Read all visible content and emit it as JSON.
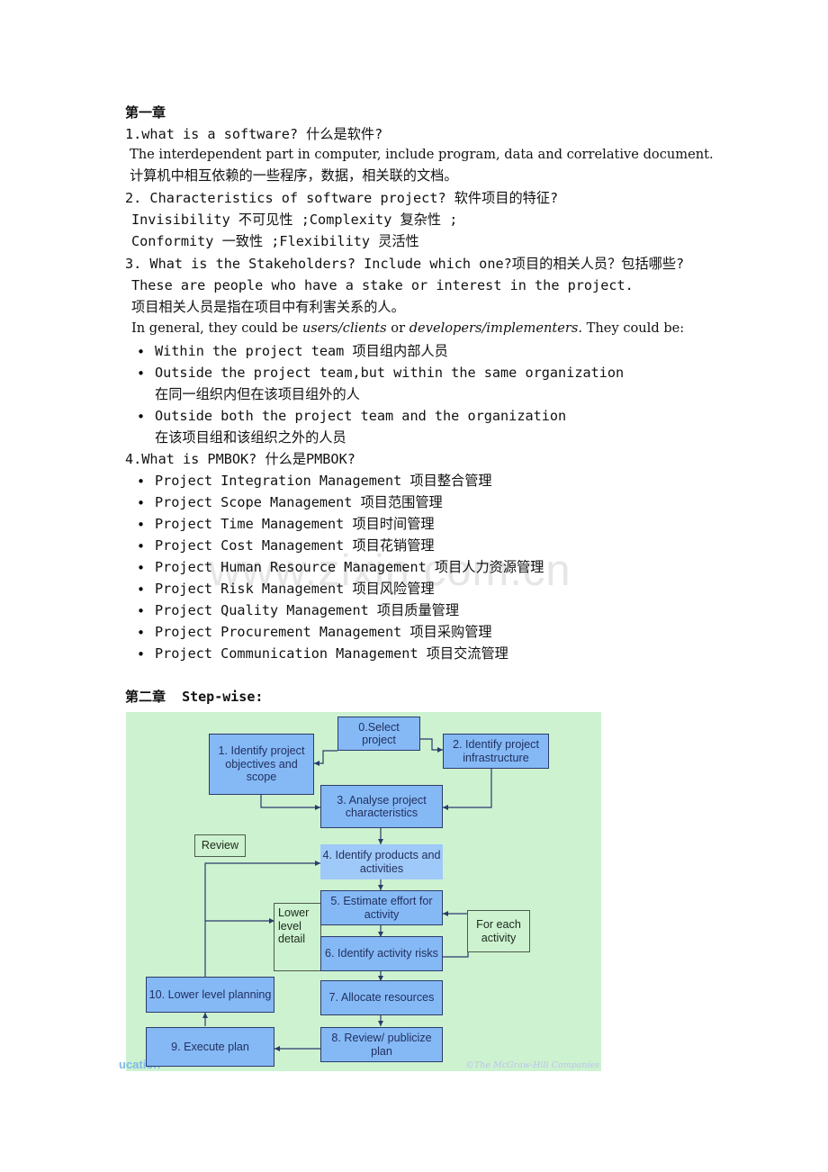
{
  "document": {
    "chapter1": {
      "heading": "第一章",
      "q1": {
        "question": "1.what is a software? 什么是软件?",
        "answer_en": "The interdependent part in computer, include program, data and correlative document.",
        "answer_cn": "计算机中相互依赖的一些程序，数据，相关联的文档。"
      },
      "q2": {
        "question": "2. Characteristics of software project? 软件项目的特征?",
        "line1": "Invisibility 不可见性 ;Complexity  复杂性 ;",
        "line2": "Conformity   一致性   ;Flexibility 灵活性"
      },
      "q3": {
        "question": "3. What is the Stakeholders? Include which one?项目的相关人员？包括哪些?",
        "answer_en": "These are people who have a stake or interest in the project.",
        "answer_cn": "项目相关人员是指在项目中有利害关系的人。",
        "general_pre": "In general, they could be ",
        "general_it1": "users/clients",
        "general_mid": " or ",
        "general_it2": "developers/implementers.",
        "general_post": " They could be:",
        "bullets": [
          {
            "en": "Within the project team 项目组内部人员",
            "cn": ""
          },
          {
            "en": "Outside the project team,but within the same organization",
            "cn": "在同一组织内但在该项目组外的人"
          },
          {
            "en": "Outside both the project team and the organization",
            "cn": "在该项目组和该组织之外的人员"
          }
        ]
      },
      "q4": {
        "question": "4.What is PMBOK? 什么是PMBOK?",
        "bullets": [
          "Project Integration Management 项目整合管理",
          "Project Scope Management 项目范围管理",
          "Project Time Management 项目时间管理",
          "Project Cost Management 项目花销管理",
          "Project Human Resource Management 项目人力资源管理",
          "Project Risk Management 项目风险管理",
          "Project  Quality Management 项目质量管理",
          "Project Procurement Management 项目采购管理",
          "Project Communication Management 项目交流管理"
        ]
      }
    },
    "chapter2": {
      "heading": "第二章",
      "subtitle": "Step-wise:"
    },
    "watermark": "www.zixin.com.cn"
  },
  "diagram": {
    "background_color": "#cdf2d0",
    "box_color": "#85b9f5",
    "boxes": {
      "b0": "0.Select project",
      "b1": "1. Identify project objectives and scope",
      "b2": "2. Identify project infrastructure",
      "b3": "3. Analyse project characteristics",
      "b4": "4. Identify products and activities",
      "b5": "5. Estimate effort for activity",
      "b6": "6. Identify activity risks",
      "b7": "7. Allocate resources",
      "b8": "8. Review/ publicize plan",
      "b9": "9. Execute plan",
      "b10": "10. Lower level planning",
      "review": "Review",
      "lower_level_detail": "Lower level detail",
      "for_each_activity": "For each activity"
    },
    "credit": "©The McGraw-Hill Companies",
    "credit_left": "ucation"
  }
}
